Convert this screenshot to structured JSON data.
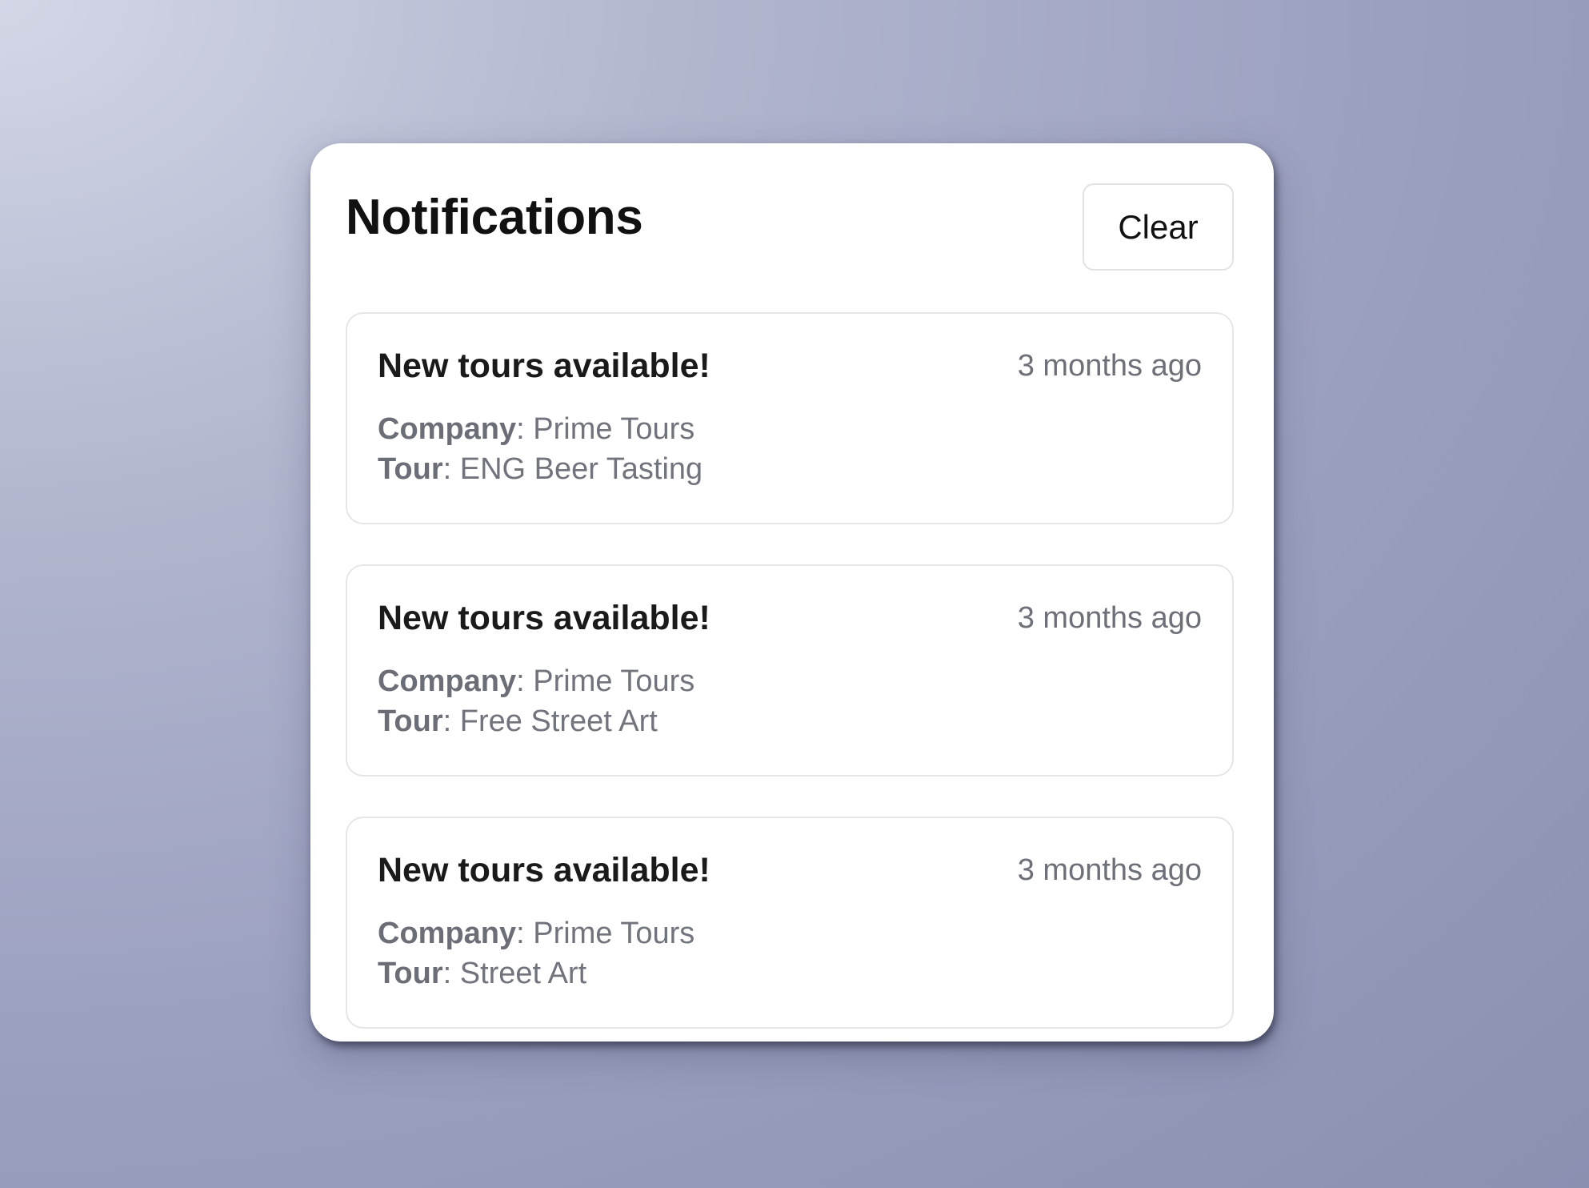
{
  "panel": {
    "title": "Notifications",
    "clear_label": "Clear"
  },
  "notifications": [
    {
      "title": "New tours available!",
      "time": "3 months ago",
      "company_label": "Company",
      "company": "Prime Tours",
      "tour_label": "Tour",
      "tour": "ENG Beer Tasting"
    },
    {
      "title": "New tours available!",
      "time": "3 months ago",
      "company_label": "Company",
      "company": "Prime Tours",
      "tour_label": "Tour",
      "tour": "Free Street Art"
    },
    {
      "title": "New tours available!",
      "time": "3 months ago",
      "company_label": "Company",
      "company": "Prime Tours",
      "tour_label": "Tour",
      "tour": "Street Art"
    }
  ]
}
